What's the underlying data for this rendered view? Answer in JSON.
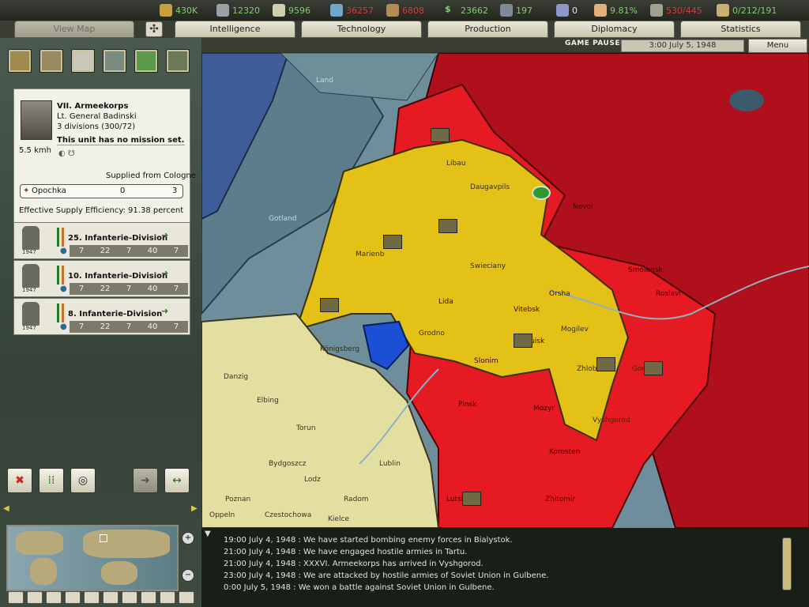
{
  "resources": [
    {
      "name": "energy",
      "icon": "energy-icon",
      "value": "430K",
      "color": "#7fcf6e"
    },
    {
      "name": "metal",
      "icon": "metal-icon",
      "value": "12320",
      "color": "#7fcf6e"
    },
    {
      "name": "rare_materials",
      "icon": "rare-materials-icon",
      "value": "9596",
      "color": "#7fcf6e"
    },
    {
      "name": "oil",
      "icon": "oil-icon",
      "value": "36257",
      "color": "#d23b3b"
    },
    {
      "name": "supplies",
      "icon": "supplies-icon",
      "value": "6808",
      "color": "#d23b3b"
    },
    {
      "name": "money",
      "icon": "money-icon",
      "value": "23662",
      "color": "#7fcf6e"
    },
    {
      "name": "manpower",
      "icon": "manpower-icon",
      "value": "197",
      "color": "#7fcf6e"
    },
    {
      "name": "transport",
      "icon": "transport-icon",
      "value": "0",
      "color": "#e6e6e6"
    },
    {
      "name": "dissent",
      "icon": "dissent-icon",
      "value": "9.81%",
      "color": "#7fcf6e"
    },
    {
      "name": "convoys",
      "icon": "convoy-icon",
      "value": "530/445",
      "color": "#d23b3b"
    },
    {
      "name": "escorts",
      "icon": "escort-icon",
      "value": "0/212/191",
      "color": "#7fcf6e"
    }
  ],
  "tabs": [
    {
      "label": "View Map",
      "active": true
    },
    {
      "label": "Intelligence"
    },
    {
      "label": "Technology"
    },
    {
      "label": "Production"
    },
    {
      "label": "Diplomacy"
    },
    {
      "label": "Statistics"
    }
  ],
  "status": {
    "paused": "GAME PAUSED",
    "datetime": "3:00 July 5, 1948",
    "menu": "Menu"
  },
  "unit": {
    "name": "VII. Armeekorps",
    "commander": "Lt. General Badinski",
    "divisions": "3 divisions (300/72)",
    "mission": "This unit has no mission set.",
    "speed": "5.5 kmh",
    "supplied": "Supplied from Cologne",
    "province": "Opochka",
    "province_a": "0",
    "province_b": "3",
    "efficiency": "Effective Supply Efficiency: 91.38 percent"
  },
  "divisions": [
    {
      "name": "25. Infanterie-Division",
      "year": "1947",
      "stats": [
        "7",
        "22",
        "7",
        "40",
        "7"
      ]
    },
    {
      "name": "10. Infanterie-Division",
      "year": "1947",
      "stats": [
        "7",
        "22",
        "7",
        "40",
        "7"
      ]
    },
    {
      "name": "8. Infanterie-Division",
      "year": "1947",
      "stats": [
        "7",
        "22",
        "7",
        "40",
        "7"
      ]
    }
  ],
  "map_labels": {
    "land": "Land",
    "gotland": "Gotland",
    "marienburg": "Marienb",
    "konigsberg": "Königsberg",
    "danzig": "Danzig",
    "elbing": "Elbing",
    "torun": "Torun",
    "lodz": "Lodz",
    "poznan": "Poznan",
    "radom": "Radom",
    "lublin": "Lublin",
    "kielce": "Kielce",
    "czestochowa": "Czestochowa",
    "oppeln": "Oppeln",
    "bydgoszcz": "Bydgoszcz",
    "grodno": "Grodno",
    "swieciany": "Swieciany",
    "daugavpils": "Daugavpils",
    "libau": "Libau",
    "mogilev": "Mogilev",
    "zhlobin": "Zhlobin",
    "vyshgorod": "Vyshgorod",
    "gomel": "Gomel",
    "novol": "Novol",
    "bobruisk": "Bobruisk",
    "mozyr": "Mozyr",
    "pinsk": "Pinsk",
    "korosten": "Korosten",
    "zhitomir": "Zhitomir",
    "roslavl": "Roslavl",
    "smolensk": "Smolensk",
    "lutsk": "Lutsk",
    "orsha": "Orsha",
    "slonim": "Slonim",
    "lida": "Lida",
    "vitebsk": "Vitebsk"
  },
  "messages": [
    "19:00 July 4, 1948 : We have started bombing enemy forces in Bialystok.",
    "21:00 July 4, 1948 : We have engaged hostile armies in Tartu.",
    "21:00 July 4, 1948 : XXXVI. Armeekorps has arrived in Vyshgorod.",
    "23:00 July 4, 1948 : We are attacked by hostile armies of Soviet Union in Gulbene.",
    "0:00 July 5, 1948 : We won a battle against Soviet Union in Gulbene."
  ]
}
